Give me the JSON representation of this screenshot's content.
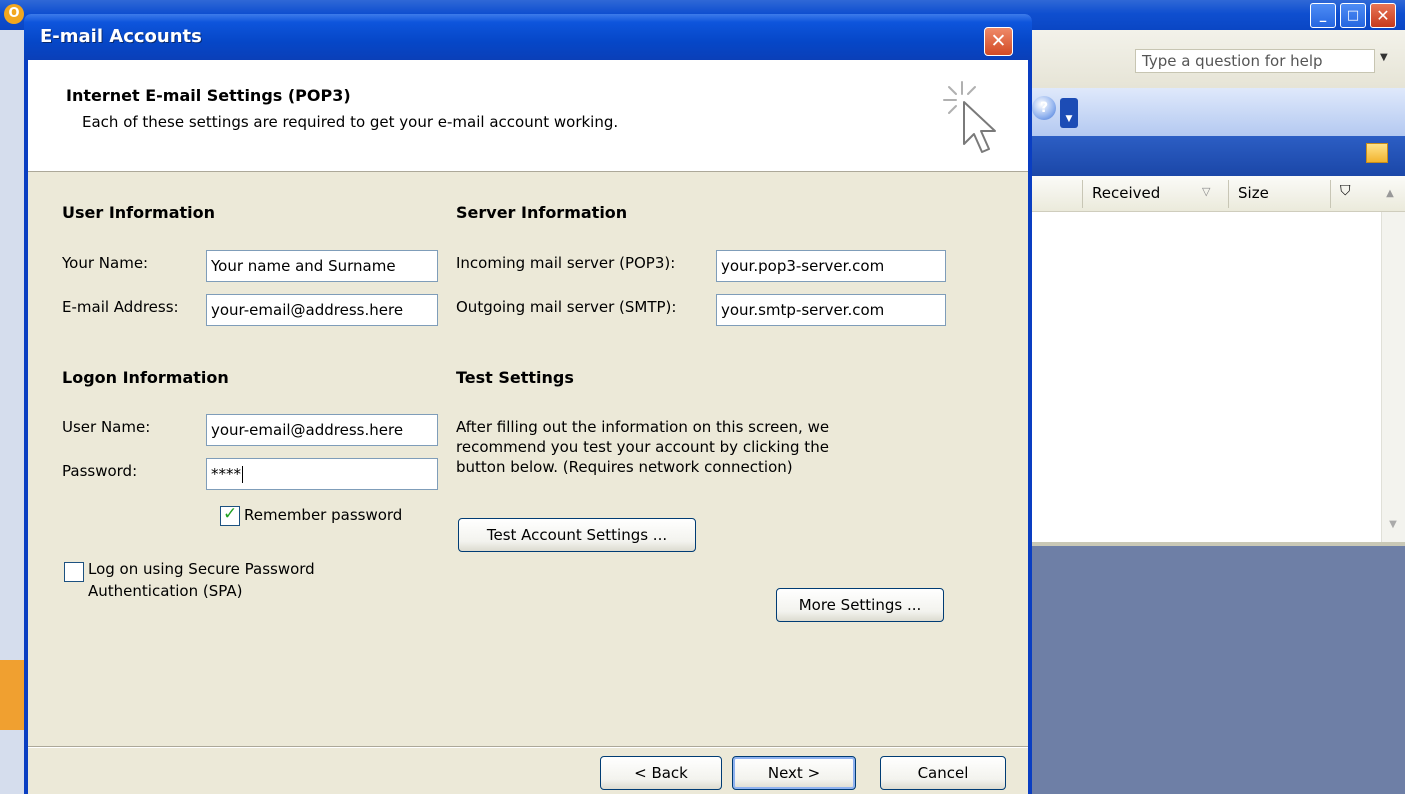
{
  "background_app": {
    "help_box_placeholder": "Type a question for help",
    "columns": {
      "received": "Received",
      "size": "Size"
    }
  },
  "dialog": {
    "title": "E-mail Accounts",
    "header": {
      "title": "Internet E-mail Settings (POP3)",
      "subtitle": "Each of these settings are required to get your e-mail account working."
    },
    "user_info": {
      "section_title": "User Information",
      "name_label": "Your Name:",
      "name_value": "Your name and Surname",
      "email_label": "E-mail Address:",
      "email_value": "your-email@address.here"
    },
    "server_info": {
      "section_title": "Server Information",
      "incoming_label": "Incoming mail server (POP3):",
      "incoming_value": "your.pop3-server.com",
      "outgoing_label": "Outgoing mail server (SMTP):",
      "outgoing_value": "your.smtp-server.com"
    },
    "logon_info": {
      "section_title": "Logon Information",
      "username_label": "User Name:",
      "username_value": "your-email@address.here",
      "password_label": "Password:",
      "password_value": "****",
      "remember_label": "Remember password",
      "remember_checked": true,
      "spa_label_line1": "Log on using Secure Password",
      "spa_label_line2": "Authentication (SPA)",
      "spa_checked": false
    },
    "test_settings": {
      "section_title": "Test Settings",
      "description_line1": "After filling out the information on this screen, we",
      "description_line2": "recommend you test your account by clicking the",
      "description_line3": "button below. (Requires network connection)",
      "test_button": "Test Account Settings ..."
    },
    "more_settings_button": "More Settings ...",
    "footer": {
      "back": "< Back",
      "next": "Next >",
      "cancel": "Cancel"
    },
    "close_glyph": "✕"
  },
  "colors": {
    "titlebar_blue": "#0647c8",
    "dialog_face": "#ece9d8",
    "button_border": "#003c74",
    "check_green": "#21a121"
  },
  "icons": [
    "app-icon",
    "minimize-icon",
    "maximize-icon",
    "close-icon",
    "help-icon",
    "chevron-icon",
    "folder-icon",
    "sort-icon",
    "flag-icon",
    "wizard-cursor-icon"
  ]
}
